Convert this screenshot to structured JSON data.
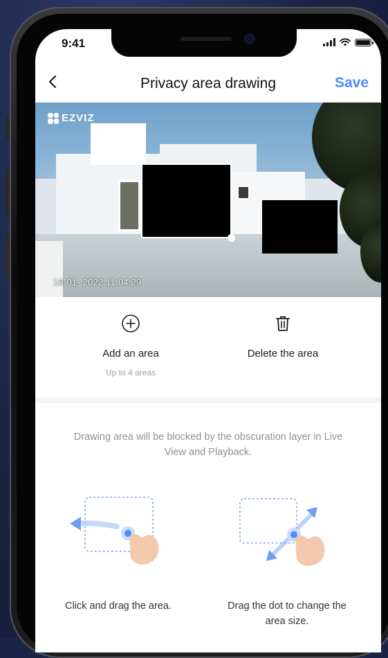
{
  "status_bar": {
    "time": "9:41"
  },
  "nav": {
    "title": "Privacy area drawing",
    "save_label": "Save"
  },
  "preview": {
    "brand": "EZVIZ",
    "timestamp": "18-01- 2022 11:04:29"
  },
  "actions": {
    "add": {
      "label": "Add an area",
      "hint": "Up to 4 areas"
    },
    "delete": {
      "label": "Delete the area"
    }
  },
  "info_text": "Drawing area will be blocked by the obscuration layer in Live View and Playback.",
  "tips": [
    {
      "caption": "Click and drag the area."
    },
    {
      "caption": "Drag the dot to change the area size."
    }
  ],
  "colors": {
    "accent": "#4d8ef7",
    "background": "#1c2445"
  }
}
